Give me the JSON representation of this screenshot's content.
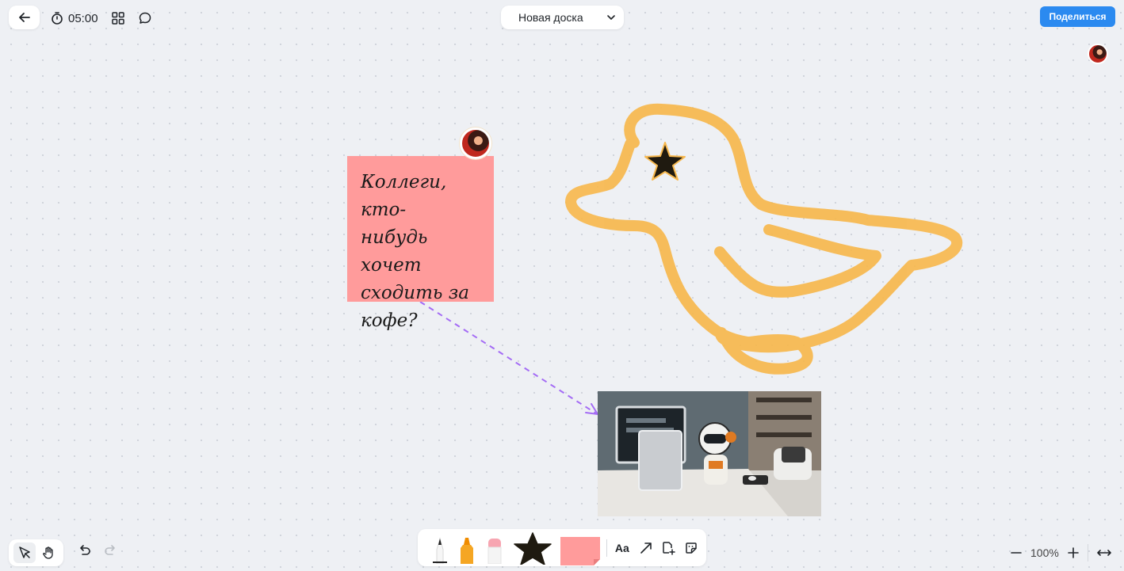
{
  "header": {
    "back_icon": "arrow-left-icon",
    "timer": {
      "icon": "stopwatch-icon",
      "value": "05:00"
    },
    "apps_icon": "grid-icon",
    "comments_icon": "comment-icon",
    "board_title": "Новая доска",
    "share_label": "Поделиться"
  },
  "canvas": {
    "sticky_note": {
      "lines": [
        "Коллеги, кто-",
        "нибудь хочет",
        "сходить за",
        "кофе?"
      ],
      "color": "#ff9b9b",
      "highlight_color": "#ffa033"
    },
    "drawing_color": "#f7b84e",
    "arrow_color": "#a46cf5",
    "star_color": "#1f1a10"
  },
  "bottom_left": {
    "select_icon": "cursor-icon",
    "hand_icon": "hand-icon"
  },
  "history": {
    "undo_icon": "undo-icon",
    "redo_icon": "redo-icon"
  },
  "toolbar": {
    "tools": [
      "pen",
      "marker",
      "eraser",
      "shape-star",
      "sticky-note"
    ],
    "text_label": "Aa",
    "arrow_icon": "arrow-icon",
    "add_page_icon": "add-page-icon",
    "sticker_icon": "sticker-icon"
  },
  "zoom": {
    "value": "100%",
    "zoom_out_icon": "minus-icon",
    "zoom_in_icon": "plus-icon",
    "fit_icon": "fit-width-icon"
  }
}
